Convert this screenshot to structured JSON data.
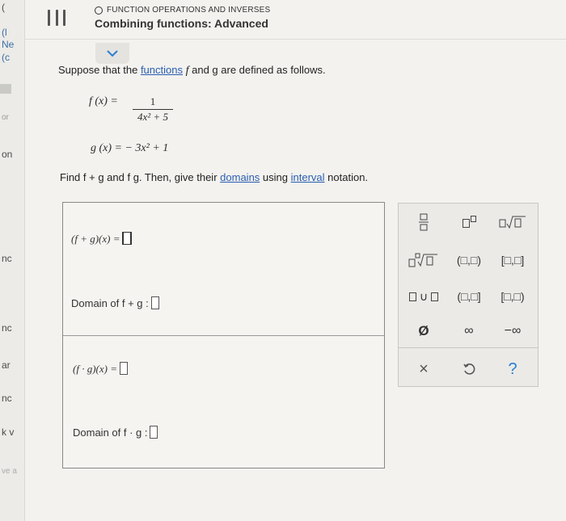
{
  "left_strip": {
    "frag1": "(",
    "frag2": "(l",
    "frag3": "Ne",
    "frag4": "(c",
    "frag5": "or",
    "frag6": "on",
    "frag7": "nc",
    "frag8": "nc",
    "frag9": "ar",
    "frag10": "nc",
    "frag11": "k v",
    "frag12": "ve a"
  },
  "header": {
    "topic": "FUNCTION OPERATIONS AND INVERSES",
    "title": "Combining functions: Advanced"
  },
  "problem": {
    "prompt_pre": "Suppose that the",
    "prompt_link": "functions",
    "prompt_post": "and g are defined as follows.",
    "f_lhs": "f (x) =",
    "f_num": "1",
    "f_den": "4x² + 5",
    "g_def": "g (x) = − 3x² + 1",
    "find_pre": "Find f + g and f g. Then, give their",
    "find_link1": "domains",
    "find_mid": "using",
    "find_link2": "interval",
    "find_post": "notation."
  },
  "answers": {
    "sum_label": "(f + g)(x) =",
    "sum_domain_label": "Domain of f + g :",
    "prod_label": "(f · g)(x) =",
    "prod_domain_label": "Domain of f · g :"
  },
  "palette": {
    "open_open": "(□,□)",
    "closed_closed": "[□,□]",
    "closed_open": "(□,□]",
    "open_closed": "[□,□)",
    "empty_set": "Ø",
    "infinity": "∞",
    "neg_infinity": "−∞",
    "clear": "×",
    "help": "?"
  }
}
